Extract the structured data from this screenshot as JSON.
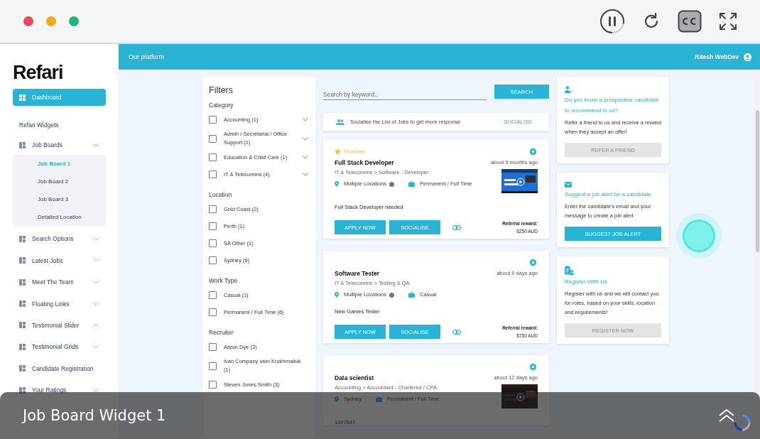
{
  "player": {
    "playback": {
      "level": 0.78
    },
    "cc": {
      "on": true
    }
  },
  "sidebar": {
    "logo": "Refari",
    "items": [
      {
        "kind": "dashboard",
        "label": "Dashboard",
        "selected": true
      },
      {
        "kind": "heading",
        "label": "Refari Widgets",
        "selected": false
      },
      {
        "kind": "group",
        "label": "Job Boards",
        "selected": false,
        "expanded": true,
        "children": [
          {
            "label": "Job Board 1",
            "selected": true
          },
          {
            "label": "Job Board 2",
            "selected": false
          },
          {
            "label": "Job Board 3",
            "selected": false
          },
          {
            "label": "Detailed Location",
            "selected": false
          }
        ]
      },
      {
        "kind": "group",
        "label": "Search Options",
        "selected": false,
        "expanded": false
      },
      {
        "kind": "group",
        "label": "Latest Jobs",
        "selected": false,
        "expanded": false
      },
      {
        "kind": "group",
        "label": "Meet The Team",
        "selected": false,
        "expanded": false
      },
      {
        "kind": "group",
        "label": "Floating Links",
        "selected": false,
        "expanded": false
      },
      {
        "kind": "group",
        "label": "Testimonial Slider",
        "selected": false,
        "expanded": false
      },
      {
        "kind": "group",
        "label": "Testimonial Grids",
        "selected": false,
        "expanded": false
      },
      {
        "kind": "link",
        "label": "Candidate Registration",
        "selected": false
      },
      {
        "kind": "group",
        "label": "Your Ratings",
        "selected": false,
        "expanded": false
      }
    ]
  },
  "header": {
    "title": "Our platform",
    "user": "Ritesh WebDev"
  },
  "filters": {
    "title": "Filters",
    "groups": [
      {
        "title": "Category",
        "options": [
          {
            "label": "Accounting (1)",
            "checked": false,
            "expandable": true
          },
          {
            "label": "Admin / Secretarial / Office Support (1)",
            "checked": false,
            "expandable": true
          },
          {
            "label": "Education & Child Care (1)",
            "checked": false,
            "expandable": true
          },
          {
            "label": "IT & Telecomms (4)",
            "checked": false,
            "expandable": true
          }
        ]
      },
      {
        "title": "Location",
        "options": [
          {
            "label": "Gold Coast (2)",
            "checked": false,
            "expandable": false
          },
          {
            "label": "Perth (1)",
            "checked": false,
            "expandable": false
          },
          {
            "label": "SA Other (1)",
            "checked": false,
            "expandable": false
          },
          {
            "label": "Sydney (6)",
            "checked": false,
            "expandable": false
          }
        ]
      },
      {
        "title": "Work Type",
        "options": [
          {
            "label": "Casual (1)",
            "checked": false,
            "expandable": false
          },
          {
            "label": "Permanent / Full Time (6)",
            "checked": false,
            "expandable": false
          }
        ]
      },
      {
        "title": "Recruiter",
        "options": [
          {
            "label": "Aaron Dye (3)",
            "checked": false,
            "expandable": false
          },
          {
            "label": "Ivan Company user Krokhmaliuk (1)",
            "checked": false,
            "expandable": false
          },
          {
            "label": "Steven Jones-Smith (3)",
            "checked": false,
            "expandable": false
          }
        ]
      }
    ]
  },
  "search": {
    "placeholder": "Search by keyword..",
    "button": "SEARCH"
  },
  "banner": {
    "text": "Socialise the List of Jobs to get more response",
    "action": "SOCIALISE"
  },
  "jobs": [
    {
      "featured": true,
      "featured_label": "Featured",
      "title": "Full Stack Developer",
      "time": "about 9 months ago",
      "category": "IT & Telecomms > Software - Developer",
      "location": "Multiple Locations",
      "location_info": true,
      "work_type": "Permanent / Full Time",
      "description": "Full Stack Developer needed",
      "apply": "APPLY NOW",
      "socialise": "SOCIALISE",
      "reward_label": "Referral reward:",
      "reward": "$250 AUD"
    },
    {
      "featured": false,
      "title": "Software Tester",
      "time": "about 9 days ago",
      "category": "IT & Telecomms > Testing & QA",
      "location": "Multiple Locations",
      "location_info": true,
      "work_type": "Casual",
      "description": "New Games Tester",
      "apply": "APPLY NOW",
      "socialise": "SOCIALISE",
      "reward_label": "Referral reward:",
      "reward": "$750 AUD"
    },
    {
      "featured": false,
      "title": "Data scientist",
      "time": "about 12 days ago",
      "category": "Accounting > Accountant - Chartered / CPA",
      "location": "Sydney",
      "location_info": false,
      "work_type": "Permanent / Full Time",
      "description": "1047647"
    }
  ],
  "side_cards": [
    {
      "kind": "refer",
      "title": "Do you know a prospective candidate to recommend to us?",
      "text": "Refer a friend to us and receive a reward when they accept an offer!",
      "button": "REFER A FRIEND",
      "disabled": true
    },
    {
      "kind": "alert",
      "title": "Suggest a job alert for a candidate",
      "text": "Enter the candidate's email and your message to create a job alert",
      "button": "SUGGEST JOB ALERT",
      "disabled": false
    },
    {
      "kind": "register",
      "title": "Register With Us",
      "text": "Register with us and we will contact you for roles, based on your skills, location and requirements!",
      "button": "REGISTER NOW",
      "disabled": true
    }
  ],
  "overlay": {
    "title": "Job Board Widget 1"
  }
}
